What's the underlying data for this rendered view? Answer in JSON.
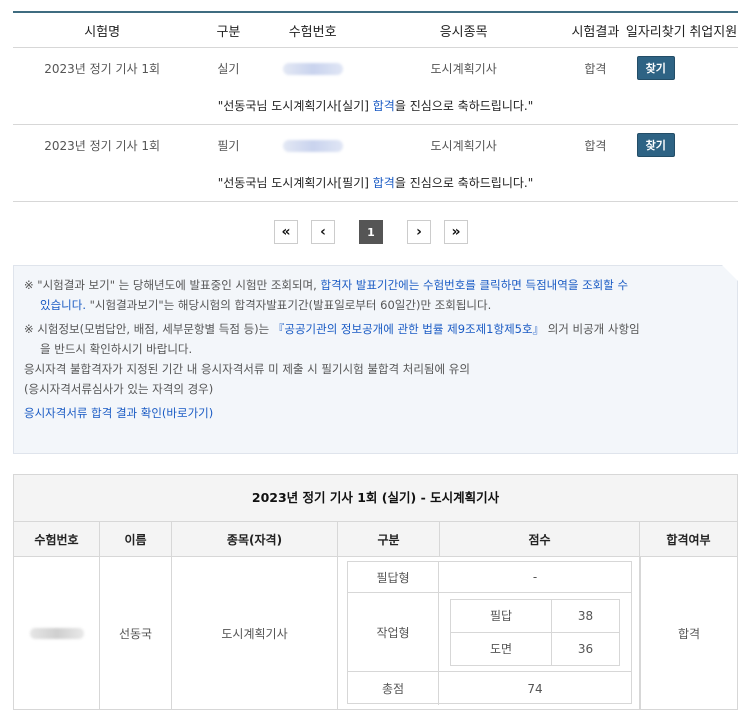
{
  "results": {
    "headers": [
      "시험명",
      "구분",
      "수험번호",
      "응시종목",
      "시험결과",
      "일자리찾기",
      "취업지원"
    ],
    "rows": [
      {
        "exam": "2023년 정기 기사 1회",
        "type": "실기",
        "field": "도시계획기사",
        "result": "합격",
        "find_label": "찾기",
        "msg_pre": "\"선동국님 도시계획기사[실기] ",
        "msg_pass": "합격",
        "msg_post": "을 진심으로 축하드립니다.\""
      },
      {
        "exam": "2023년 정기 기사 1회",
        "type": "필기",
        "field": "도시계획기사",
        "result": "합격",
        "find_label": "찾기",
        "msg_pre": "\"선동국님 도시계획기사[필기] ",
        "msg_pass": "합격",
        "msg_post": "을 진심으로 축하드립니다.\""
      }
    ]
  },
  "pager": {
    "first": "«",
    "prev": "‹",
    "current": "1",
    "next": "›",
    "last": "»"
  },
  "notice": {
    "line1_a": "※ \"시험결과 보기\" 는 당해년도에 발표중인 시험만 조회되며, ",
    "line1_b": "합격자 발표기간에는 수험번호를 클릭하면 득점내역을 조회할 수",
    "line2_a": "있습니다.",
    "line2_b": " \"시험결과보기\"는 해당시험의 합격자발표기간(발표일로부터 60일간)만 조회됩니다.",
    "line3_a": "※ 시험정보(모범답안, 배점, 세부문항별 득점 등)는 ",
    "line3_b": "『공공기관의 정보공개에 관한 법률 제9조제1항제5호』",
    "line3_c": " 의거 비공개 사항임",
    "line4": "을 반드시 확인하시기 바랍니다.",
    "line5": "응시자격 불합격자가 지정된 기간 내 응시자격서류 미 제출 시 필기시험 불합격 처리됨에 유의",
    "line6": "(응시자격서류심사가 있는 자격의 경우)",
    "link": "응시자격서류 합격 결과 확인(바로가기)"
  },
  "detail": {
    "title": "2023년 정기 기사 1회 (실기) - 도시계획기사",
    "headers": [
      "수험번호",
      "이름",
      "종목(자격)",
      "구분",
      "점수",
      "합격여부"
    ],
    "name": "선동국",
    "field": "도시계획기사",
    "pass": "합격",
    "written_label": "필답형",
    "written_score": "-",
    "work_label": "작업형",
    "work_items": [
      {
        "label": "필답",
        "score": "38"
      },
      {
        "label": "도면",
        "score": "36"
      }
    ],
    "total_label": "총점",
    "total_score": "74"
  }
}
